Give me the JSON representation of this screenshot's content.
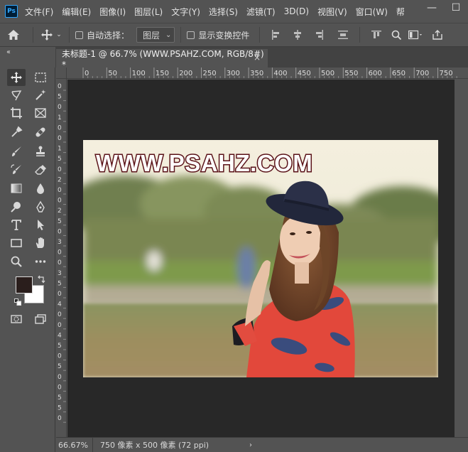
{
  "app": {
    "logo": "Ps"
  },
  "menu": [
    "文件(F)",
    "编辑(E)",
    "图像(I)",
    "图层(L)",
    "文字(Y)",
    "选择(S)",
    "滤镜(T)",
    "3D(D)",
    "视图(V)",
    "窗口(W)",
    "帮"
  ],
  "window_controls": {
    "minimize": "—",
    "maximize": "☐"
  },
  "options": {
    "auto_select_label": "自动选择：",
    "auto_select_target": "图层",
    "show_transform_label": "显示变换控件"
  },
  "document_tab": {
    "title": "未标题-1 @ 66.7% (WWW.PSAHZ.COM, RGB/8#) *",
    "close": "×"
  },
  "ruler": {
    "h_ticks": [
      "0",
      "50",
      "100",
      "150",
      "200",
      "250",
      "300",
      "350",
      "400",
      "450",
      "500",
      "550",
      "600",
      "650",
      "700",
      "750"
    ],
    "v_ticks": [
      "0",
      "5",
      "0",
      "1",
      "0",
      "0",
      "1",
      "5",
      "0",
      "2",
      "0",
      "0",
      "2",
      "5",
      "0",
      "3",
      "0",
      "0",
      "3",
      "5",
      "0",
      "4",
      "0",
      "0",
      "4",
      "5",
      "0",
      "5",
      "0",
      "0",
      "5",
      "5",
      "0"
    ]
  },
  "canvas": {
    "watermark_text": "WWW.PSAHZ.COM"
  },
  "colors": {
    "foreground": "#2a1e1c",
    "background": "#ffffff",
    "text_fill": "#ffffff",
    "text_stroke": "#5a1218"
  },
  "status": {
    "zoom": "66.67%",
    "doc_info": "750 像素 x 500 像素 (72 ppi)",
    "arrow": "›"
  }
}
